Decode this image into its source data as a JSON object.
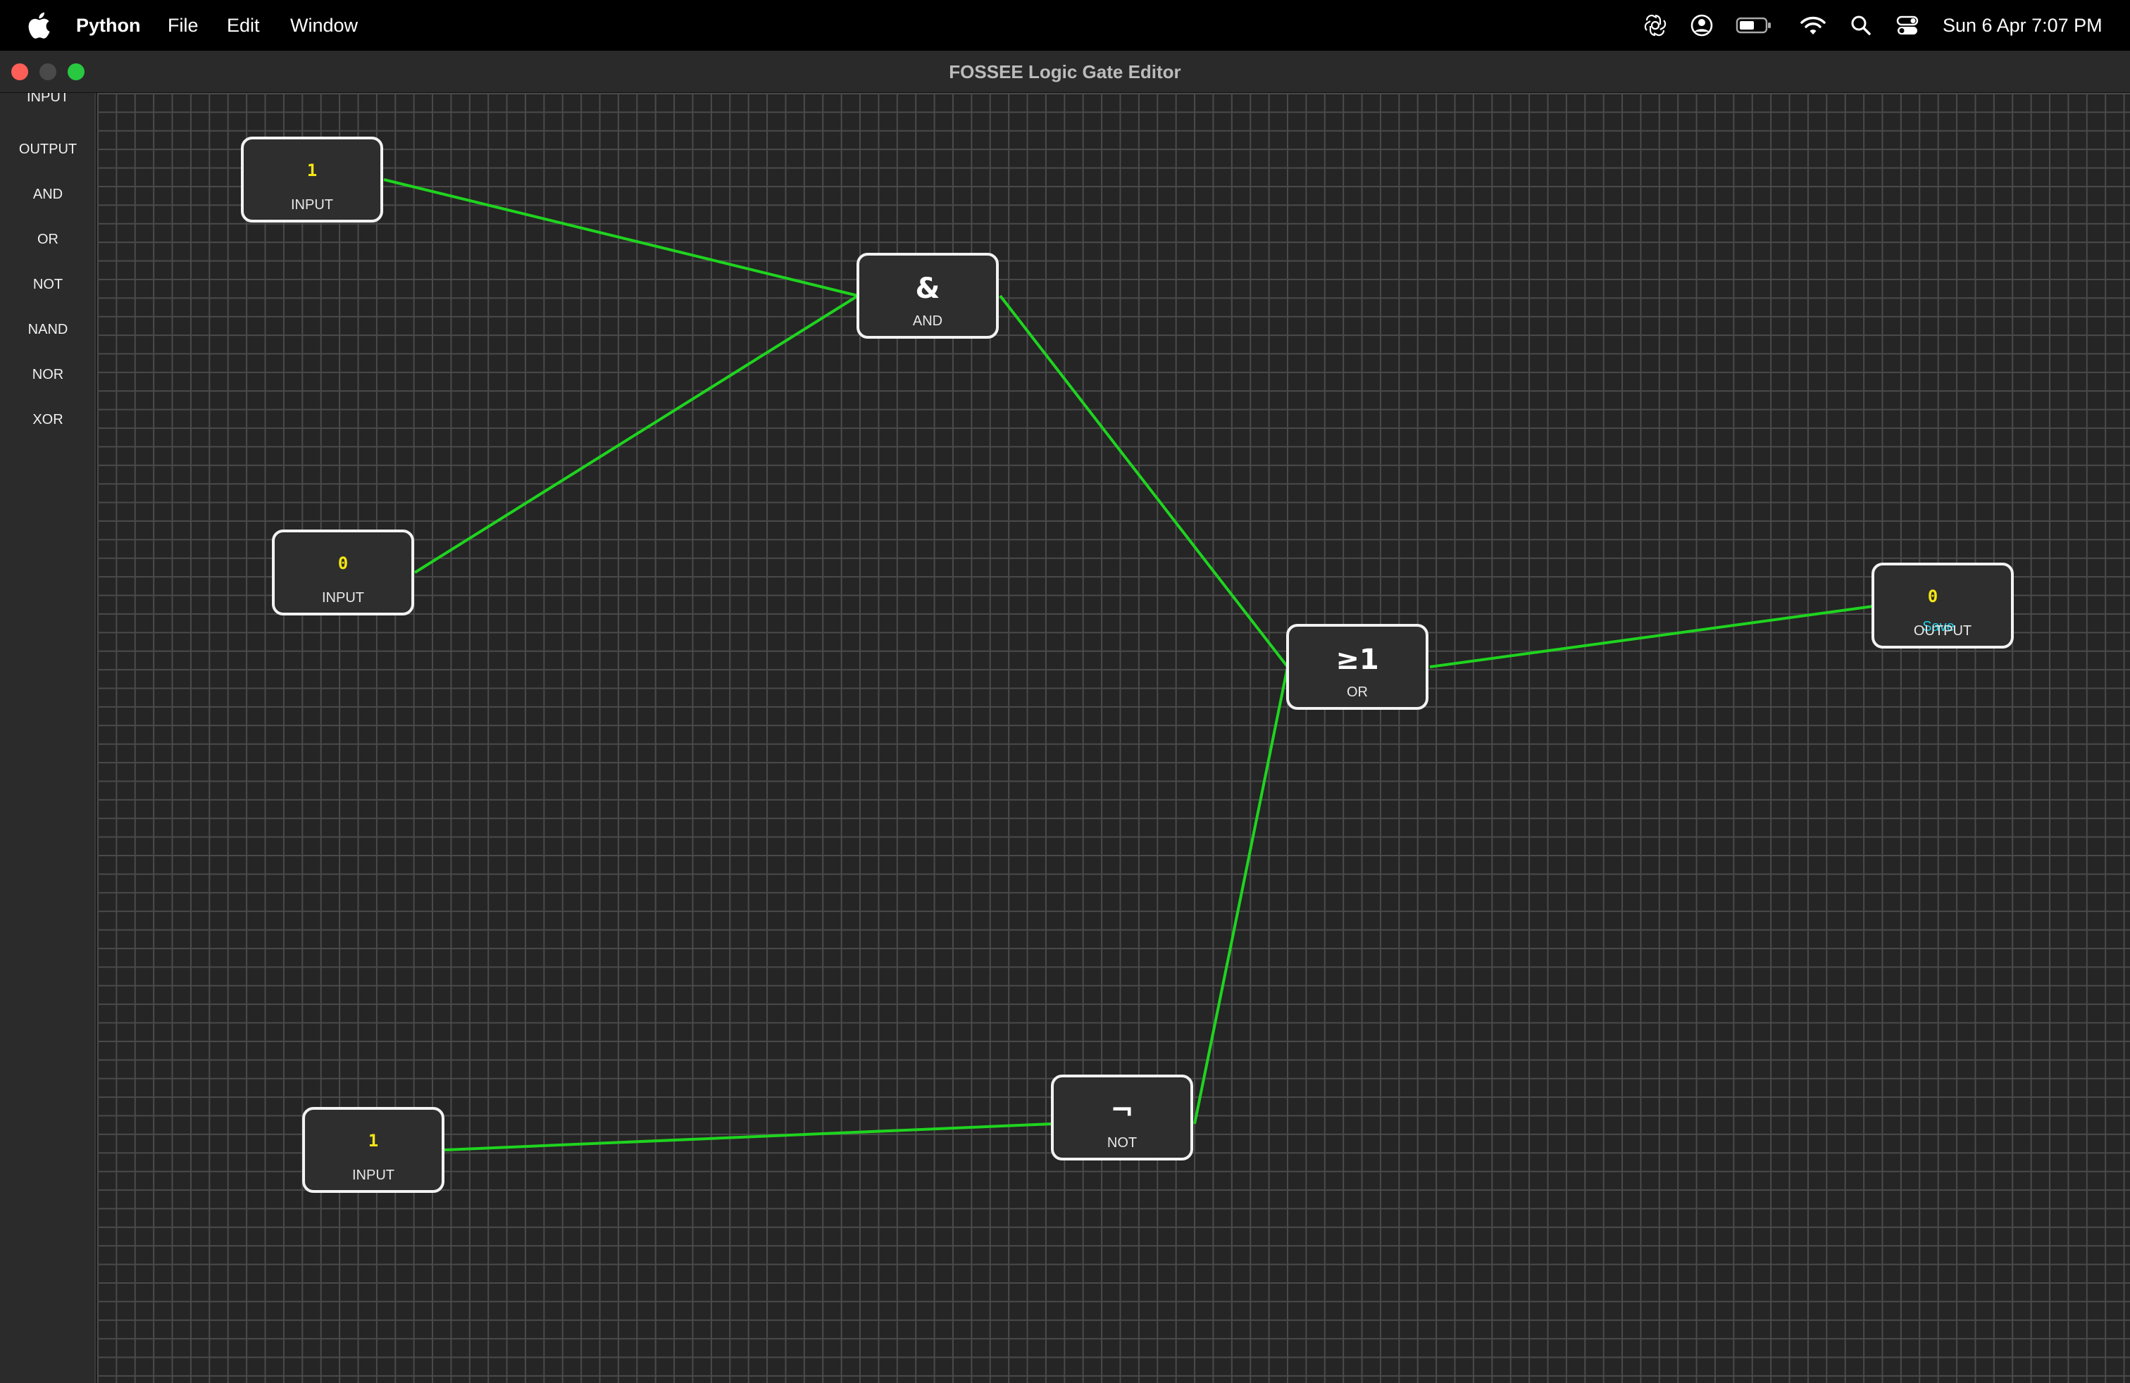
{
  "menubar": {
    "app_name": "Python",
    "menus": [
      "File",
      "Edit",
      "Window"
    ],
    "status_icons": [
      "openai-icon",
      "user-circle-icon",
      "battery-icon",
      "wifi-icon",
      "search-icon",
      "control-center-icon"
    ],
    "clock": "Sun 6 Apr  7:07 PM"
  },
  "window": {
    "title": "FOSSEE Logic Gate Editor"
  },
  "sidebar": {
    "items": [
      "INPUT",
      "OUTPUT",
      "AND",
      "OR",
      "NOT",
      "NAND",
      "NOR",
      "XOR"
    ]
  },
  "canvas": {
    "grid_color": "#4a4a4a",
    "background": "#252525",
    "wire_color": "#1fd41f",
    "nodes": [
      {
        "id": "in1",
        "type": "INPUT",
        "value": "1",
        "label": "INPUT"
      },
      {
        "id": "in2",
        "type": "INPUT",
        "value": "0",
        "label": "INPUT"
      },
      {
        "id": "in3",
        "type": "INPUT",
        "value": "1",
        "label": "INPUT"
      },
      {
        "id": "and1",
        "type": "AND",
        "symbol": "&",
        "label": "AND"
      },
      {
        "id": "or1",
        "type": "OR",
        "symbol": "≥1",
        "label": "OR"
      },
      {
        "id": "not1",
        "type": "NOT",
        "symbol": "¬",
        "label": "NOT"
      },
      {
        "id": "out1",
        "type": "OUTPUT",
        "value": "0",
        "label": "OUTPUT",
        "overlay": "Save"
      }
    ],
    "wires": [
      {
        "from": "in1",
        "to": "and1"
      },
      {
        "from": "in2",
        "to": "and1"
      },
      {
        "from": "and1",
        "to": "or1"
      },
      {
        "from": "in3",
        "to": "not1"
      },
      {
        "from": "not1",
        "to": "or1"
      },
      {
        "from": "or1",
        "to": "out1"
      }
    ]
  }
}
